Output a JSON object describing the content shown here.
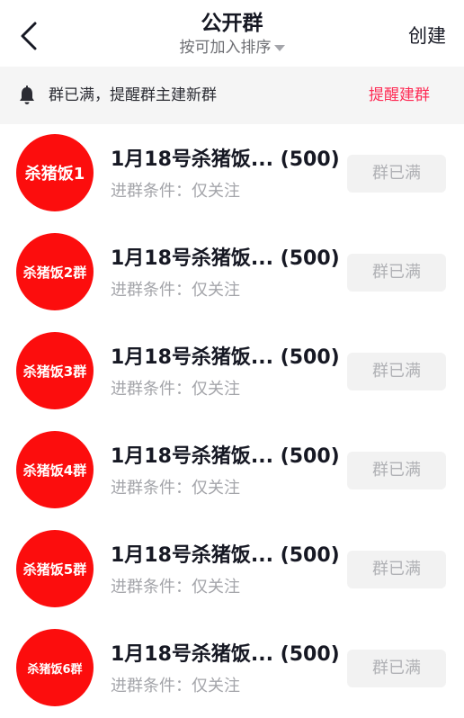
{
  "header": {
    "title": "公开群",
    "sort_label": "按可加入排序",
    "create_label": "创建"
  },
  "notice": {
    "text": "群已满，提醒群主建新群",
    "action_label": "提醒建群"
  },
  "colors": {
    "accent": "#fe2c55",
    "avatar_bg": "#fc0d0d",
    "notice_bg": "#f5f5f5",
    "button_bg": "#f2f2f2"
  },
  "groups": [
    {
      "avatar_text": "杀猪饭1",
      "name": "1月18号杀猪饭... (500)",
      "condition": "进群条件：仅关注",
      "status_label": "群已满"
    },
    {
      "avatar_text": "杀猪饭2群",
      "name": "1月18号杀猪饭... (500)",
      "condition": "进群条件：仅关注",
      "status_label": "群已满"
    },
    {
      "avatar_text": "杀猪饭3群",
      "name": "1月18号杀猪饭... (500)",
      "condition": "进群条件：仅关注",
      "status_label": "群已满"
    },
    {
      "avatar_text": "杀猪饭4群",
      "name": "1月18号杀猪饭... (500)",
      "condition": "进群条件：仅关注",
      "status_label": "群已满"
    },
    {
      "avatar_text": "杀猪饭5群",
      "name": "1月18号杀猪饭... (500)",
      "condition": "进群条件：仅关注",
      "status_label": "群已满"
    },
    {
      "avatar_text": "杀猪饭6群",
      "name": "1月18号杀猪饭... (500)",
      "condition": "进群条件：仅关注",
      "status_label": "群已满"
    }
  ]
}
